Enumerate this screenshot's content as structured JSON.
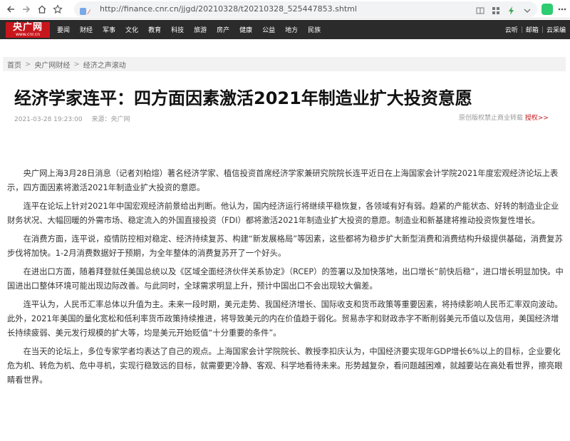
{
  "browser": {
    "url": "http://finance.cnr.cn/jjgd/20210328/t20210328_525447853.shtml"
  },
  "site": {
    "logo_text": "央广网",
    "logo_sub": "www.cnr.cn",
    "nav_items": [
      "要闻",
      "财经",
      "军事",
      "文化",
      "教育",
      "科技",
      "旅游",
      "房产",
      "健康",
      "公益",
      "地方",
      "民族"
    ],
    "nav_right": [
      "云听",
      "邮箱",
      "云采编"
    ]
  },
  "breadcrumb": {
    "items": [
      "首页",
      "央广网财经",
      "经济之声滚动"
    ],
    "separator": ">"
  },
  "article": {
    "title": "经济学家连平：四方面因素激活2021年制造业扩大投资意愿",
    "datetime": "2021-03-28 19:23:00",
    "source": "来源：央广网",
    "copyright_text": "原创版权禁止商业转载",
    "copyright_link": "授权>>",
    "paragraphs": [
      "央广网上海3月28日消息（记者刘柏煊）著名经济学家、植信投资首席经济学家兼研究院院长连平近日在上海国家会计学院2021年度宏观经济论坛上表示，四方面因素将激活2021年制造业扩大投资的意愿。",
      "连平在论坛上针对2021年中国宏观经济前景给出判断。他认为，国内经济运行将继续平稳恢复，各领域有好有弱。趋紧的产能状态、好转的制造业企业财务状况、大幅回暖的外需市场、稳定流入的外国直接投资（FDI）都将激活2021年制造业扩大投资的意愿。制造业和新基建将推动投资恢复性增长。",
      "在消费方面，连平说，疫情防控相对稳定、经济持续复苏、构建“新发展格局”等因素，这些都将为稳步扩大新型消费和消费结构升级提供基础，消费复苏步伐将加快。1-2月消费数据好于预期，为全年整体的消费复苏开了一个好头。",
      "在进出口方面，随着拜登就任美国总统以及《区域全面经济伙伴关系协定》（RCEP）的签署以及加快落地，出口增长“前快后稳”，进口增长明显加快。中国进出口整体环境可能出现边际改善。与此同时，全球需求明显上升，预计中国出口不会出现较大偏差。",
      "连平认为，人民币汇率总体以升值为主。未来一段时期，美元走势、我国经济增长、国际收支和货币政策等重要因素，将持续影响人民币汇率双向波动。此外，2021年美国的量化宽松和低利率货币政策持续推进，将导致美元的内在价值趋于弱化。贸易赤字和财政赤字不断削弱美元币值以及信用，美国经济增长持续疲弱、美元发行规模的扩大等，均是美元开始贬值“十分重要的条件”。",
      "在当天的论坛上，多位专家学者均表达了自己的观点。上海国家会计学院院长、教授李扣庆认为，中国经济要实现年GDP增长6%以上的目标，企业要化危为机、转危为机、危中寻机，实现行稳致远的目标，就需要更冷静、客观、科学地看待未来。形势越复杂，看问题越困难，就越要站在高处看世界，擦亮眼睛看世界。"
    ]
  },
  "colors": {
    "brand_red": "#c8161d",
    "nav_bg": "#2b2b2b"
  }
}
